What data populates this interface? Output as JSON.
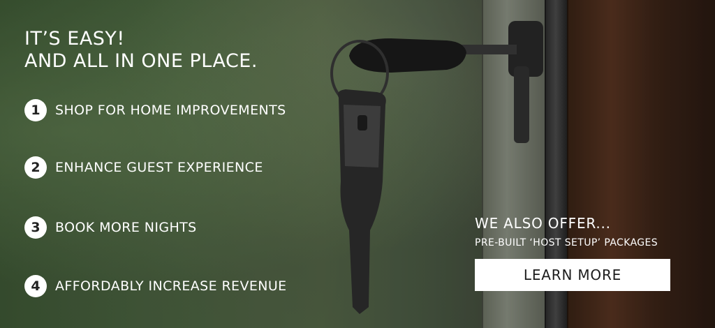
{
  "headline": {
    "line1": "IT’S EASY!",
    "line2": "AND ALL IN ONE PLACE."
  },
  "steps": [
    {
      "number": "1",
      "label": "SHOP FOR HOME IMPROVEMENTS"
    },
    {
      "number": "2",
      "label": "ENHANCE GUEST EXPERIENCE"
    },
    {
      "number": "3",
      "label": "BOOK MORE NIGHTS"
    },
    {
      "number": "4",
      "label": "AFFORDABLY INCREASE REVENUE"
    }
  ],
  "offer": {
    "title": "WE ALSO OFFER...",
    "subtitle": "PRE-BUILT ‘HOST SETUP’ PACKAGES",
    "button_label": "LEARN MORE"
  },
  "background": {
    "photo_subject": "door-key-in-lock-photo"
  }
}
